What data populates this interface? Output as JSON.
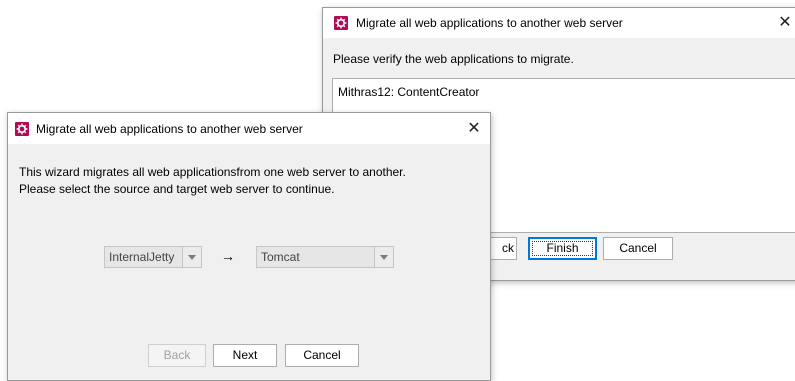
{
  "back_window": {
    "title": "Migrate all web applications to another web server",
    "close_glyph": "✕",
    "instruction": "Please verify the web applications to migrate.",
    "list_items": [
      "Mithras12: ContentCreator"
    ],
    "buttons": {
      "back_partial": "ck",
      "finish": "Finish",
      "cancel": "Cancel"
    }
  },
  "front_window": {
    "title": "Migrate all web applications to another web server",
    "close_glyph": "✕",
    "description_line1": "This wizard migrates all web applicationsfrom one web server to another.",
    "description_line2": "Please select the source and target web server to continue.",
    "source_server": "InternalJetty",
    "arrow": "→",
    "target_server": "Tomcat",
    "buttons": {
      "back": "Back",
      "next": "Next",
      "cancel": "Cancel"
    }
  },
  "colors": {
    "app_icon": "#b00b57",
    "dialog_body": "#f0f0f0",
    "default_button_border": "#0078d7"
  },
  "icons": {
    "app": "gear-icon",
    "close": "close-icon",
    "dropdown": "chevron-down-icon",
    "arrow": "arrow-right-icon"
  }
}
